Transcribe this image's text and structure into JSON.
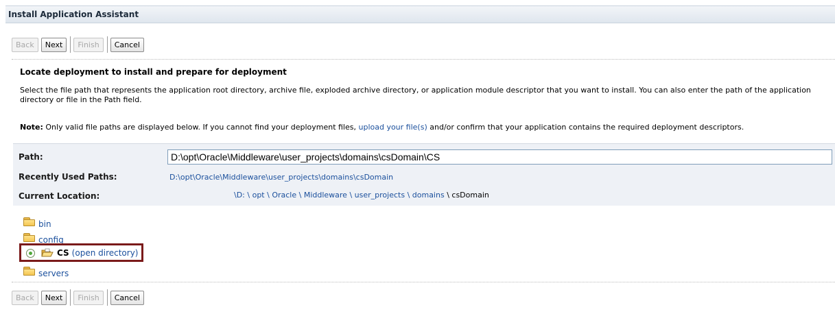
{
  "window": {
    "title": "Install Application Assistant"
  },
  "toolbar": {
    "back": "Back",
    "next": "Next",
    "finish": "Finish",
    "cancel": "Cancel"
  },
  "content": {
    "heading": "Locate deployment to install and prepare for deployment",
    "description": "Select the file path that represents the application root directory, archive file, exploded archive directory, or application module descriptor that you want to install. You can also enter the path of the application directory or file in the Path field.",
    "note_label": "Note:",
    "note_before": " Only valid file paths are displayed below. If you cannot find your deployment files, ",
    "note_link": "upload your file(s)",
    "note_after": " and/or confirm that your application contains the required deployment descriptors."
  },
  "path_section": {
    "path_label": "Path:",
    "path_value": "D:\\opt\\Oracle\\Middleware\\user_projects\\domains\\csDomain\\CS",
    "recent_label": "Recently Used Paths:",
    "recent_value": "D:\\opt\\Oracle\\Middleware\\user_projects\\domains\\csDomain",
    "location_label": "Current Location:",
    "breadcrumbs": [
      "\\D:",
      "\\ opt",
      "\\ Oracle",
      "\\ Middleware",
      "\\ user_projects",
      "\\ domains"
    ],
    "current": "\\ csDomain"
  },
  "tree": {
    "items": [
      {
        "name": "bin"
      },
      {
        "name": "config"
      },
      {
        "name": "CS",
        "link": "(open directory)",
        "selected": true
      },
      {
        "name": "servers"
      }
    ]
  },
  "colors": {
    "link": "#1a4f9c",
    "highlight_border": "#7a1a1a",
    "panel_bg": "#eef1f6"
  },
  "icons": {
    "folder": "folder-icon",
    "open_folder": "open-folder-icon",
    "radio": "radio-selected-icon"
  }
}
